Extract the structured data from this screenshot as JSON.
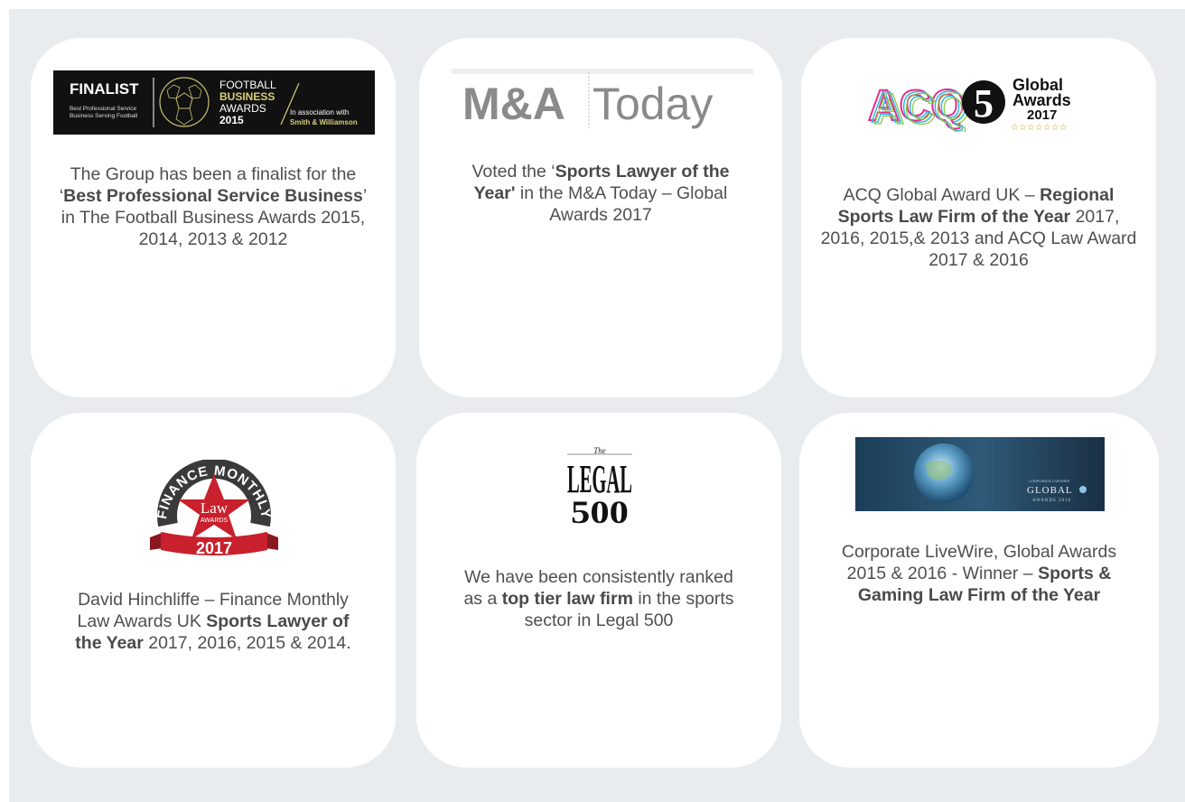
{
  "cards": [
    {
      "logo": {
        "finalist": "FINALIST",
        "subtitle_line1": "Best Professional Service",
        "subtitle_line2": "Business Serving Football",
        "line1": "FOOTBALL",
        "line2": "BUSINESS",
        "line3": "AWARDS",
        "year": "2015",
        "assoc": "In association with",
        "assoc_name": "Smith & Williamson"
      },
      "text": {
        "p1": "The Group has been a finalist for the ‘",
        "b1": "Best Professional Service Business",
        "p2": "’ in The Football Business Awards 2015, 2014, 2013 & 2012"
      }
    },
    {
      "logo": {
        "part1": "M&A",
        "part2": "Today"
      },
      "text": {
        "p1": "Voted the ‘",
        "b1": "Sports Lawyer of the Year'",
        "p2": " in the M&A Today – Global Awards 2017"
      }
    },
    {
      "logo": {
        "acq": "ACQ",
        "num": "5",
        "line1": "Global",
        "line2": "Awards",
        "year": "2017",
        "stars": "☆☆☆☆☆☆☆"
      },
      "text": {
        "p1": "ACQ Global Award UK – ",
        "b1": "Regional Sports Law Firm of the Year",
        "p2": " 2017, 2016, 2015,& 2013 and ACQ Law Award 2017 & 2016"
      }
    },
    {
      "logo": {
        "ring": "FINANCE MONTHLY",
        "star_top": "Law",
        "star_bottom": "AWARDS",
        "year": "2017"
      },
      "text": {
        "p1": "David Hinchliffe – Finance Monthly Law Awards UK ",
        "b1": "Sports Lawyer of the Year",
        "p2": " 2017, 2016, 2015 & 2014."
      }
    },
    {
      "logo": {
        "the": "The",
        "word": "LEGAL",
        "num": "500"
      },
      "text": {
        "p1": "We have been consistently ranked as a ",
        "b1": "top tier law firm",
        "p2": " in the sports sector in Legal 500"
      }
    },
    {
      "logo": {
        "small": "CORPORATE LIVEWIRE",
        "global": "GLOBAL",
        "awards": "AWARDS 2016"
      },
      "text": {
        "p1": "Corporate LiveWire, Global Awards 2015 & 2016 - Winner – ",
        "b1": "Sports & Gaming Law Firm of the Year",
        "p2": ""
      }
    }
  ]
}
